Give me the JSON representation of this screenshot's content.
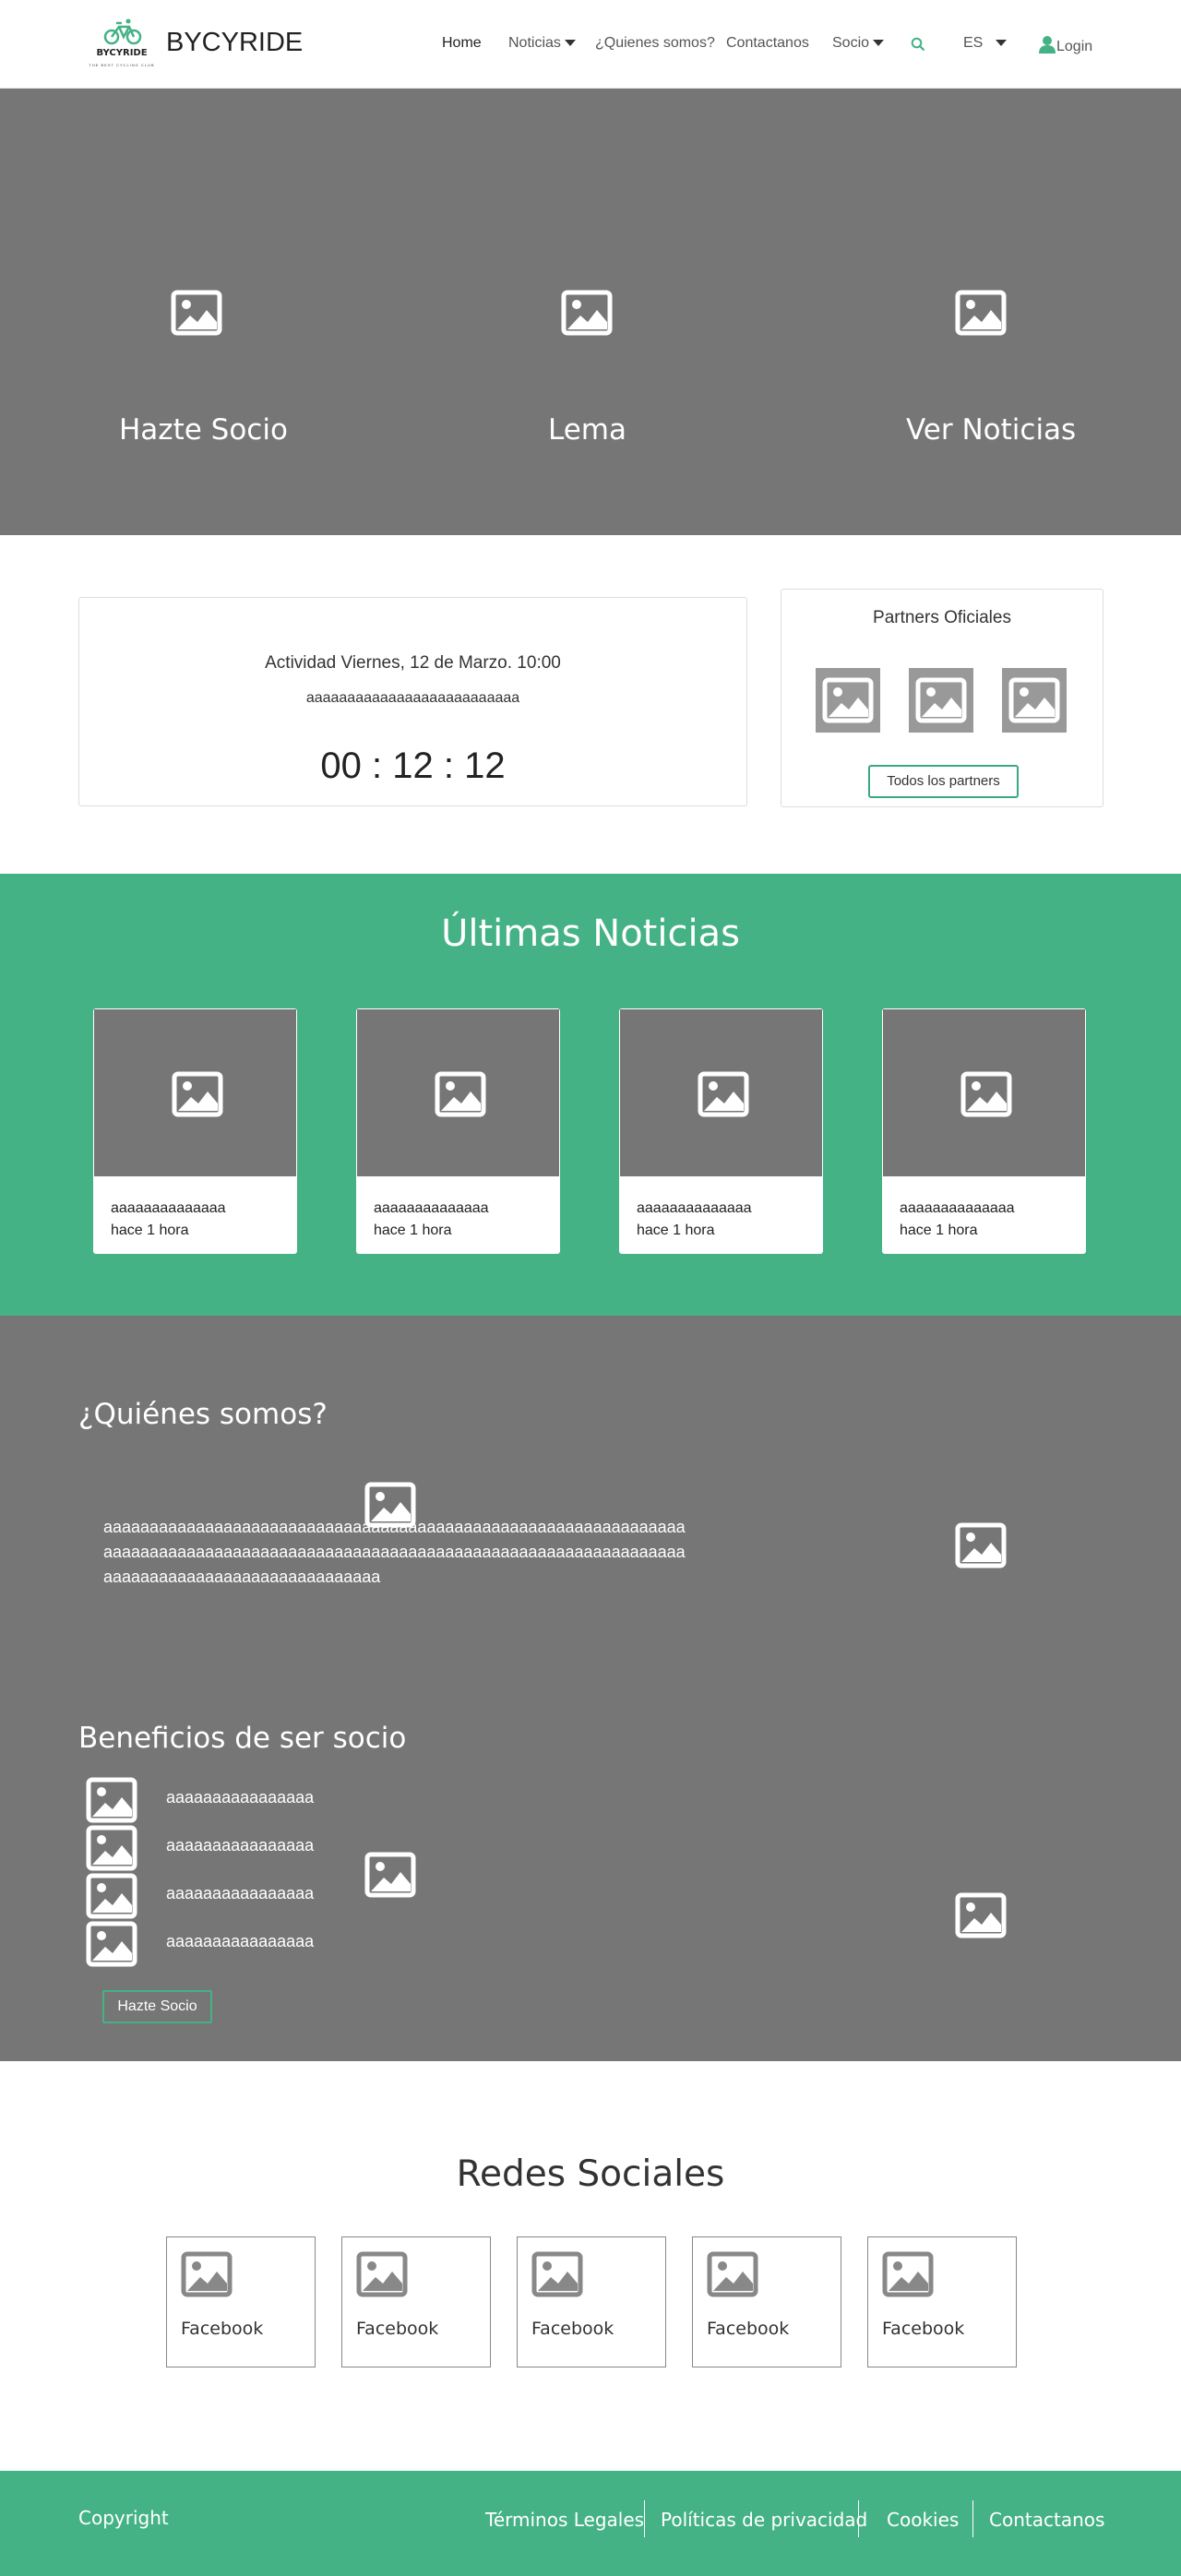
{
  "nav": {
    "logo_text": "BYCYRIDE",
    "logo_slogan": "THE BEST CYCLING CLUB",
    "brand": "BYCYRIDE",
    "links": {
      "home": "Home",
      "noticias": "Noticias",
      "quienes": "¿Quienes somos?",
      "contactanos": "Contactanos",
      "socio": "Socio",
      "lang": "ES",
      "login": "Login"
    }
  },
  "hero": {
    "items": [
      "Hazte Socio",
      "Lema",
      "Ver Noticias"
    ]
  },
  "event": {
    "title": "Actividad Viernes, 12 de Marzo. 10:00",
    "subtitle": "aaaaaaaaaaaaaaaaaaaaaaaaaa",
    "countdown": "00 : 12 : 12"
  },
  "partners": {
    "title": "Partners Oficiales",
    "button": "Todos los partners"
  },
  "news": {
    "title": "Últimas Noticias",
    "cards": [
      {
        "title": "aaaaaaaaaaaaaa",
        "date": "hace 1 hora"
      },
      {
        "title": "aaaaaaaaaaaaaa",
        "date": "hace 1 hora"
      },
      {
        "title": "aaaaaaaaaaaaaa",
        "date": "hace 1 hora"
      },
      {
        "title": "aaaaaaaaaaaaaa",
        "date": "hace 1 hora"
      }
    ]
  },
  "about": {
    "title": "¿Quiénes somos?",
    "text": "aaaaaaaaaaaaaaaaaaaaaaaaaaaaaaaaaaaaaaaaaaaaaaaaaaaaaaaaaaaaaaaaaaaaaaaaaaaaaaaaaaaaaaaaaaaaaaaaaaaaaaaaaaaaaaaaaaaaaaaaaaaaaaaaaaaaaaaaaaaaaaaaaaaaaaaaaaaa"
  },
  "benefits": {
    "title": "Beneficios de ser socio",
    "items": [
      "aaaaaaaaaaaaaaaa",
      "aaaaaaaaaaaaaaaa",
      "aaaaaaaaaaaaaaaa",
      "aaaaaaaaaaaaaaaa"
    ],
    "button": "Hazte Socio"
  },
  "social": {
    "title": "Redes Sociales",
    "items": [
      "Facebook",
      "Facebook",
      "Facebook",
      "Facebook",
      "Facebook"
    ]
  },
  "footer": {
    "copyright": "Copyright",
    "links": [
      "Términos Legales",
      "Políticas de privacidad",
      "Cookies",
      "Contactanos"
    ]
  },
  "colors": {
    "accent": "#45b286",
    "gray_section": "#767676",
    "white": "#ffffff"
  }
}
